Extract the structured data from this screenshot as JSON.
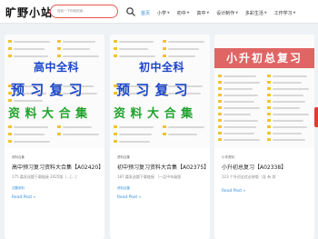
{
  "site": {
    "logo": "旷野小站"
  },
  "search": {
    "placeholder": "搜索一下你就知道…"
  },
  "nav": [
    {
      "label": "首页",
      "active": true,
      "caret": false
    },
    {
      "label": "小学",
      "active": false,
      "caret": true
    },
    {
      "label": "初中",
      "active": false,
      "caret": true
    },
    {
      "label": "高中",
      "active": false,
      "caret": true
    },
    {
      "label": "设计制作",
      "active": false,
      "caret": true
    },
    {
      "label": "多彩生活",
      "active": false,
      "caret": true
    },
    {
      "label": "工作学习",
      "active": false,
      "caret": true
    }
  ],
  "cards": [
    {
      "category": "资料合集",
      "title": "高中预习复习资料大合集【A02420】",
      "desc": "175 篇发送题下载链接 2025版（…[…]",
      "tag": "试题资料",
      "read_more": "Read Post »",
      "thumb_lines": [
        "高中全科",
        "预 习 复 习",
        "资 料 大 合 集"
      ]
    },
    {
      "category": "资料合集",
      "title": "初中预习复习资料大合集【A02375】",
      "desc": "187 篇发送题下载链接 （一品中年级版",
      "tag": "资料合集",
      "read_more": "Read Post »",
      "thumb_lines": [
        "初中全科",
        "预 习 复 习",
        "资 料 大 合 集"
      ]
    },
    {
      "category": "小学资料",
      "title": "小升初总复习【A02338】",
      "desc": "123 个升初全优必修版（含 有 其",
      "tag": "",
      "read_more": "Read Post »",
      "thumb_lines": [
        "小升初总复习"
      ]
    }
  ],
  "colors": {
    "accent": "#2f8fe0",
    "banner": "#e06565",
    "green_text": "#1fa32c",
    "blue_text": "#1b46c9"
  }
}
